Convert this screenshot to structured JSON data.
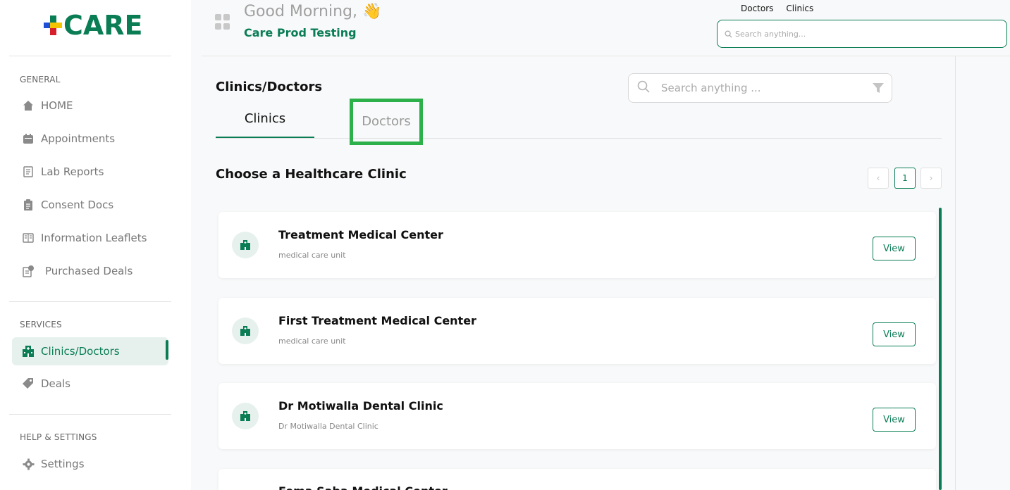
{
  "brand": {
    "logo_text": "CARE"
  },
  "sidebar": {
    "sections": [
      {
        "label": "GENERAL",
        "items": [
          {
            "label": "HOME",
            "icon": "home-icon"
          },
          {
            "label": "Appointments",
            "icon": "calendar-icon"
          },
          {
            "label": "Lab Reports",
            "icon": "lab-report-icon"
          },
          {
            "label": "Consent Docs",
            "icon": "clipboard-icon"
          },
          {
            "label": "Information Leaflets",
            "icon": "leaflet-icon"
          },
          {
            "label": "Purchased Deals",
            "icon": "purchased-deals-icon"
          }
        ]
      },
      {
        "label": "SERVICES",
        "items": [
          {
            "label": "Clinics/Doctors",
            "icon": "hospital-icon",
            "active": true
          },
          {
            "label": "Deals",
            "icon": "tag-icon"
          }
        ]
      },
      {
        "label": "HELP & SETTINGS",
        "items": [
          {
            "label": "Settings",
            "icon": "gear-icon"
          }
        ]
      }
    ]
  },
  "header": {
    "greeting": "Good Morning,",
    "greeting_emoji": "👋",
    "org_name": "Care Prod Testing",
    "links": [
      "Doctors",
      "Clinics"
    ],
    "search_placeholder": "Search anything..."
  },
  "main": {
    "title": "Clinics/Doctors",
    "search_placeholder": "Search anything ...",
    "tabs": [
      {
        "label": "Clinics",
        "active": true
      },
      {
        "label": "Doctors",
        "active": false
      }
    ],
    "section_title": "Choose a Healthcare Clinic",
    "pagination": {
      "prev": "‹",
      "current_page": "1",
      "next": "›"
    },
    "view_label": "View",
    "clinics": [
      {
        "name": "Treatment Medical Center",
        "description": "medical care unit"
      },
      {
        "name": "First Treatment Medical Center",
        "description": "medical care unit"
      },
      {
        "name": "Dr Motiwalla Dental Clinic",
        "description": "Dr Motiwalla Dental Clinic"
      },
      {
        "name": "Fema Saba Medical Center",
        "description": ""
      }
    ]
  },
  "colors": {
    "brand_green": "#0a7d55",
    "highlight_green": "#2bb04a",
    "active_bg": "#e6f1ed"
  }
}
